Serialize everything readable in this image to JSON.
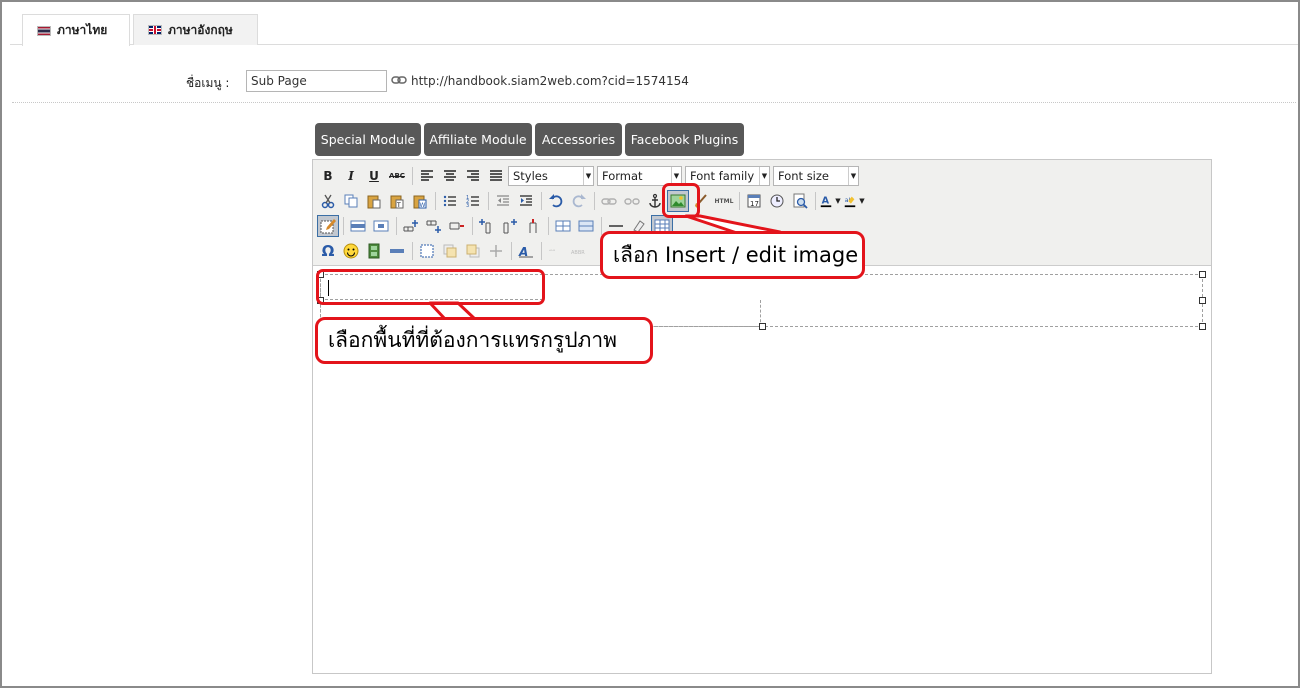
{
  "tabs": [
    {
      "label": "ภาษาไทย",
      "active": true
    },
    {
      "label": "ภาษาอังกฤษ",
      "active": false
    }
  ],
  "menu_name": {
    "label": "ชื่อเมนู :",
    "value": "Sub Page",
    "url": "http://handbook.siam2web.com?cid=1574154"
  },
  "module_buttons": [
    "Special Module",
    "Affiliate Module",
    "Accessories",
    "Facebook Plugins"
  ],
  "toolbar": {
    "bold": "B",
    "italic": "I",
    "underline": "U",
    "strike": "ABC",
    "styles": "Styles",
    "format": "Format",
    "font_family": "Font family",
    "font_size": "Font size",
    "html": "HTML",
    "char_map": "Ω"
  },
  "colors": {
    "accent_red": "#e3141b",
    "module_button": "#585858",
    "toolbar_bg": "#f0f0ee"
  },
  "callouts": {
    "insert_image": "เลือก Insert / edit image",
    "select_area": "เลือกพื้นที่ที่ต้องการแทรกรูปภาพ"
  }
}
